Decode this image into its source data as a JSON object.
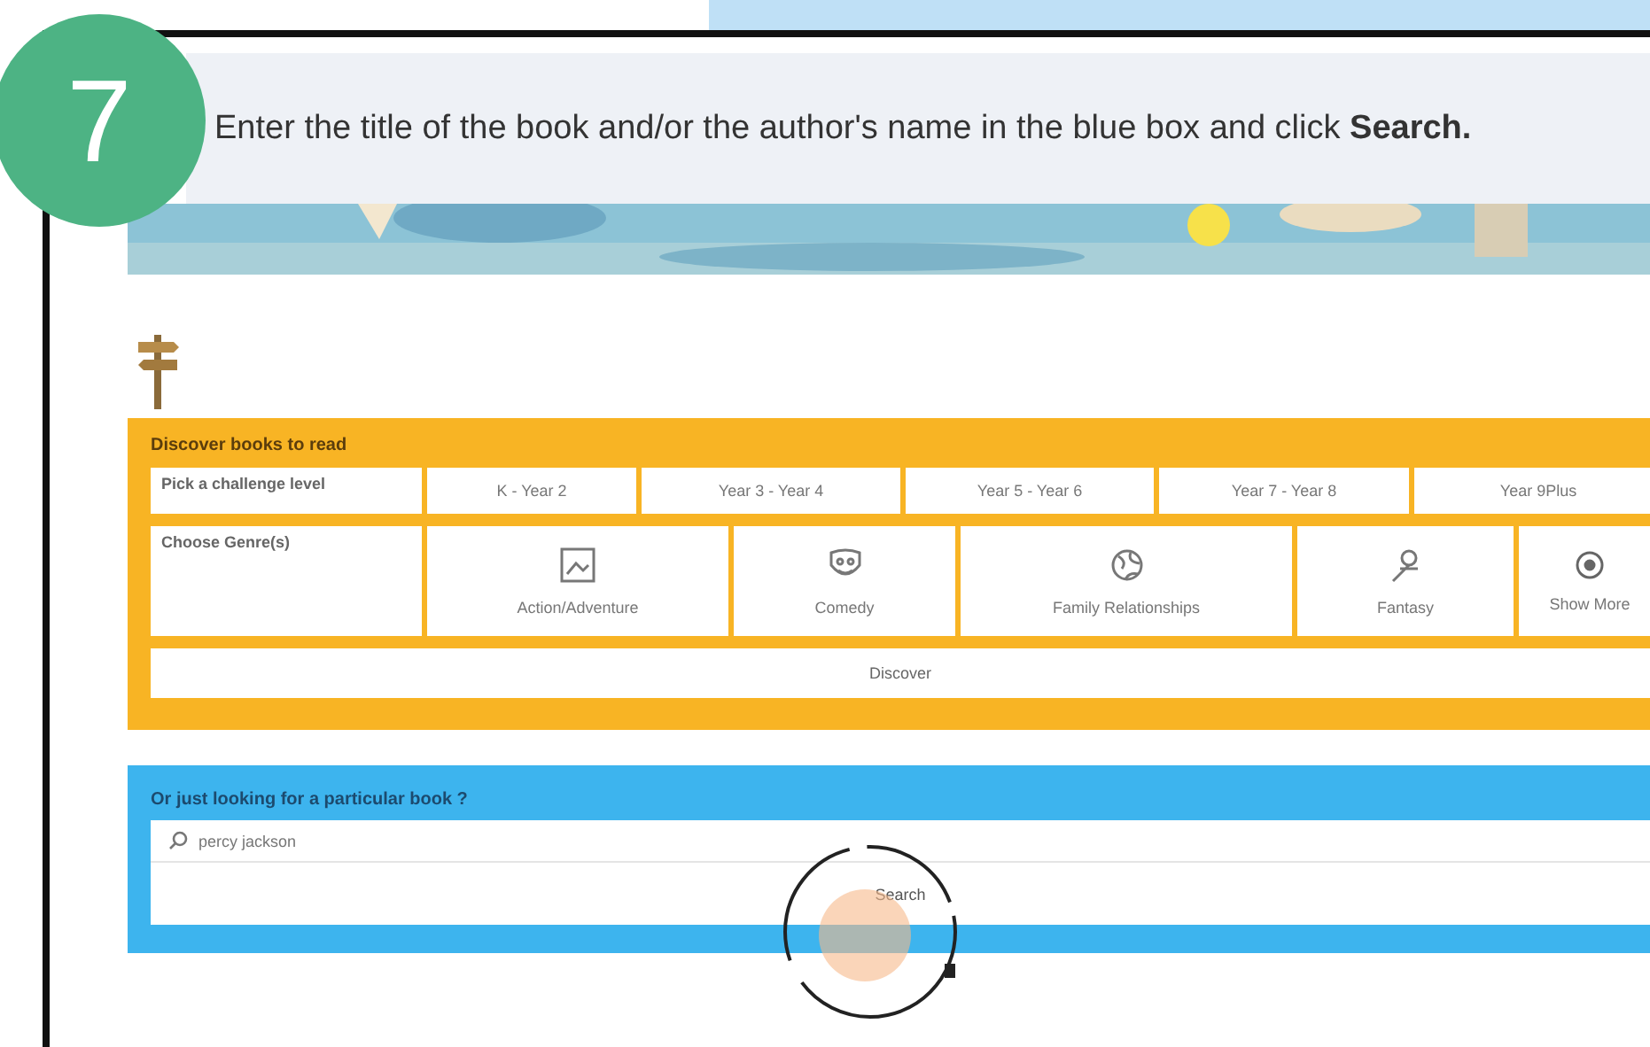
{
  "step": {
    "number": "7",
    "instruction": "Enter the title of the book and/or the author's name in the blue box and click **Search.**"
  },
  "discover": {
    "title": "Discover books to read",
    "level_label": "Pick a challenge level",
    "levels": [
      "K - Year 2",
      "Year 3 - Year 4",
      "Year 5 - Year 6",
      "Year 7 - Year 8",
      "Year 9Plus"
    ],
    "genre_label": "Choose Genre(s)",
    "genres": [
      {
        "label": "Action/Adventure",
        "kind": "frame"
      },
      {
        "label": "Comedy",
        "kind": "mask"
      },
      {
        "label": "Family Relationships",
        "kind": "globe"
      },
      {
        "label": "Fantasy",
        "kind": "figure"
      },
      {
        "label": "Show More",
        "kind": "more"
      }
    ],
    "button": "Discover"
  },
  "search": {
    "title": "Or just looking for a particular book ?",
    "value": "percy jackson",
    "button": "Search"
  }
}
